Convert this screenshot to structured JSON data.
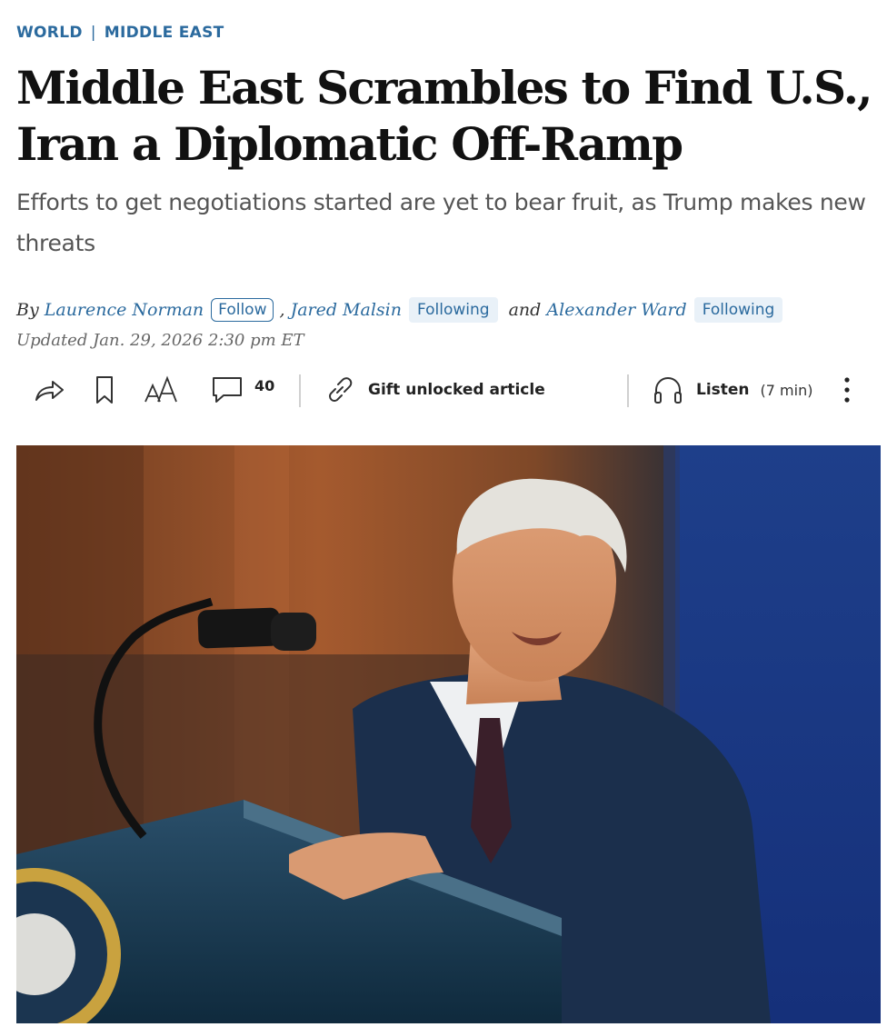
{
  "breadcrumb": {
    "section": "WORLD",
    "separator": "|",
    "subsection": "MIDDLE EAST"
  },
  "headline": {
    "line1": "Middle East Scrambles to Find U.S.,",
    "line2": "Iran a Diplomatic Off-Ramp"
  },
  "dek": "Efforts to get negotiations started are yet to bear fruit, as Trump makes new threats",
  "byline": {
    "by": "By",
    "author1": "Laurence Norman",
    "author1_button": "Follow",
    "comma": ",",
    "author2": "Jared Malsin",
    "author2_button": "Following",
    "and": "and",
    "author3": "Alexander Ward",
    "author3_button": "Following",
    "updated": "Updated Jan. 29, 2026 2:30 pm ET"
  },
  "toolbar": {
    "share_icon": "share-icon",
    "bookmark_icon": "bookmark-icon",
    "text_size_icon": "text-size-icon",
    "comments_icon": "comment-icon",
    "comments_count": "40",
    "gift_icon": "link-icon",
    "gift_label": "Gift unlocked article",
    "listen_icon": "headphones-icon",
    "listen_label": "Listen",
    "listen_duration": "(7 min)",
    "more_icon": "more-vertical-icon"
  },
  "colors": {
    "link": "#2b6a9e",
    "follow_bg": "#e9f1f8",
    "headline": "#111111",
    "dek": "#555555"
  }
}
